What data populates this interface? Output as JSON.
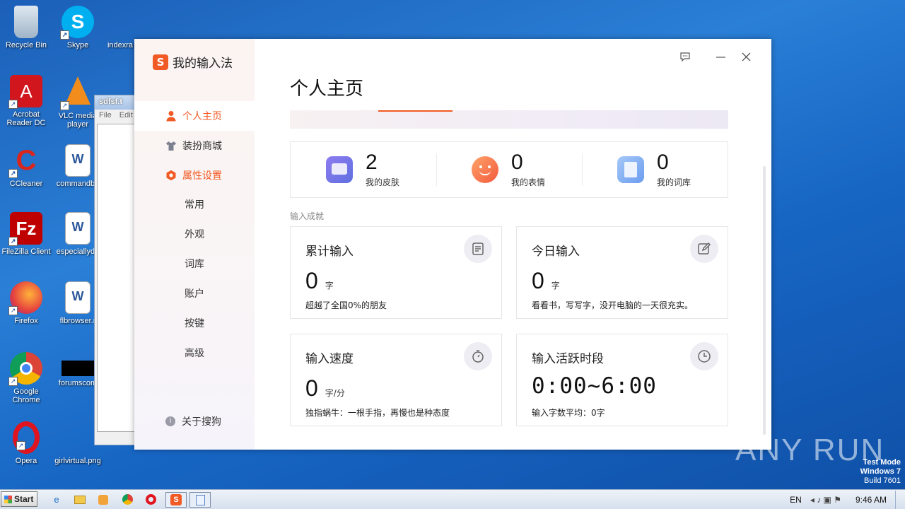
{
  "desktop": {
    "icons": [
      {
        "label": "Recycle Bin"
      },
      {
        "label": "Skype"
      },
      {
        "label": "indexra"
      },
      {
        "label": "Acrobat Reader DC"
      },
      {
        "label": "VLC media player"
      },
      {
        "label": "CCleaner"
      },
      {
        "label": "commandbo"
      },
      {
        "label": "FileZilla Client"
      },
      {
        "label": "especiallyde"
      },
      {
        "label": "Firefox"
      },
      {
        "label": "flbrowser.r"
      },
      {
        "label": "Google Chrome"
      },
      {
        "label": "forumscom"
      },
      {
        "label": "Opera"
      },
      {
        "label": "girlvirtual.png"
      }
    ],
    "notepad": {
      "title": "sdfsf.t",
      "menu_file": "File",
      "menu_edit": "Edit"
    }
  },
  "app": {
    "brand": "我的输入法",
    "logo_glyph": "S",
    "accent_color": "#f15a24",
    "nav": {
      "home": "个人主页",
      "store": "装扮商城",
      "settings": "属性设置",
      "sub": [
        "常用",
        "外观",
        "词库",
        "账户",
        "按键",
        "高级"
      ],
      "about": "关于搜狗"
    },
    "main": {
      "title": "个人主页",
      "stats": [
        {
          "value": "2",
          "label": "我的皮肤",
          "icon": "skin-icon"
        },
        {
          "value": "0",
          "label": "我的表情",
          "icon": "emoji-icon"
        },
        {
          "value": "0",
          "label": "我的词库",
          "icon": "lexicon-icon"
        }
      ],
      "section_label": "输入成就",
      "cards": {
        "total": {
          "title": "累计输入",
          "value": "0",
          "unit": "字",
          "note": "超越了全国0%的朋友"
        },
        "today": {
          "title": "今日输入",
          "value": "0",
          "unit": "字",
          "note": "看看书，写写字，没开电脑的一天很充实。"
        },
        "speed": {
          "title": "输入速度",
          "value": "0",
          "unit": "字/分",
          "note": "独指蜗牛：一根手指，再慢也是种态度"
        },
        "active": {
          "title": "输入活跃时段",
          "value": "0:00~6:00",
          "note": "输入字数平均：0字"
        }
      }
    }
  },
  "taskbar": {
    "start": "Start",
    "lang": "EN",
    "time": "9:46 AM"
  },
  "watermark": {
    "line1": "Test Mode",
    "line2": "Windows 7",
    "line3": "Build 7601",
    "brand": "ANY RUN"
  }
}
